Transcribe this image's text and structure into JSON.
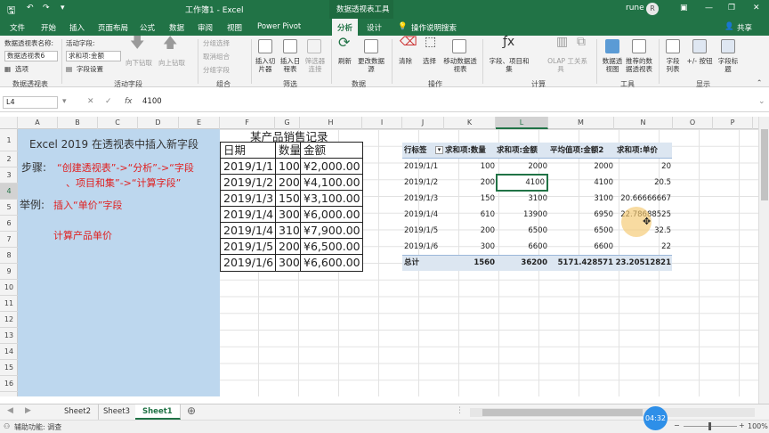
{
  "titlebar": {
    "title": "工作簿1 - Excel",
    "context_tool": "数据透视表工具",
    "user": "rune",
    "avatar": "R"
  },
  "tabs": [
    "文件",
    "开始",
    "插入",
    "页面布局",
    "公式",
    "数据",
    "审阅",
    "视图",
    "Power Pivot",
    "分析",
    "设计",
    "操作说明搜索"
  ],
  "share": "共享",
  "ribbon": {
    "pivot_name_label": "数据透视表名称:",
    "pivot_name_value": "数据透视表6",
    "options": "选项",
    "active_field_label": "活动字段:",
    "active_field_value": "求和项:金额",
    "field_settings": "字段设置",
    "drill_down": "向下钻取",
    "drill_up": "向上钻取",
    "group_selection": "分组选择",
    "ungroup": "取消组合",
    "group_field": "分组字段",
    "insert_slicer": "插入切片器",
    "insert_timeline": "插入日程表",
    "filter_connections": "筛选器连接",
    "refresh": "刷新",
    "change_source": "更改数据源",
    "clear": "清除",
    "select": "选择",
    "move_pivot": "移动数据透视表",
    "fields_items": "字段、项目和集",
    "olap": "OLAP 工具",
    "relationships": "关系",
    "pivot_chart": "数据透视图",
    "recommended": "推荐的数据透视表",
    "field_list": "字段列表",
    "buttons": "+/- 按钮",
    "field_headers": "字段标题",
    "groups": [
      "数据透视表",
      "活动字段",
      "组合",
      "筛选",
      "数据",
      "操作",
      "计算",
      "工具",
      "显示"
    ]
  },
  "formula_bar": {
    "cell": "L4",
    "value": "4100",
    "fx": "fx"
  },
  "columns": [
    "A",
    "B",
    "C",
    "D",
    "E",
    "F",
    "G",
    "H",
    "I",
    "J",
    "K",
    "L",
    "M",
    "N",
    "O",
    "P"
  ],
  "rows": [
    "1",
    "2",
    "3",
    "4",
    "5",
    "6",
    "7",
    "8",
    "9",
    "10",
    "11",
    "12",
    "13",
    "14",
    "15",
    "16"
  ],
  "panel": {
    "title": "Excel 2019 在透视表中插入新字段",
    "step_label": "步骤:",
    "step_text1": "“创建透视表”->“分析”->“字段",
    "step_text2": "、项目和集”->“计算字段”",
    "example_label": "举例:",
    "example_text": "插入“单价”字段",
    "calc_text": "计算产品单价"
  },
  "sales": {
    "title": "某产品销售记录",
    "headers": [
      "日期",
      "数量",
      "金额"
    ],
    "rows": [
      [
        "2019/1/1",
        "100",
        "¥2,000.00"
      ],
      [
        "2019/1/2",
        "200",
        "¥4,100.00"
      ],
      [
        "2019/1/3",
        "150",
        "¥3,100.00"
      ],
      [
        "2019/1/4",
        "300",
        "¥6,000.00"
      ],
      [
        "2019/1/4",
        "310",
        "¥7,900.00"
      ],
      [
        "2019/1/5",
        "200",
        "¥6,500.00"
      ],
      [
        "2019/1/6",
        "300",
        "¥6,600.00"
      ]
    ]
  },
  "pivot": {
    "headers": [
      "行标签",
      "求和项:数量",
      "求和项:金额",
      "平均值项:金额2",
      "求和项:单价"
    ],
    "rows": [
      [
        "2019/1/1",
        "100",
        "2000",
        "2000",
        "20"
      ],
      [
        "2019/1/2",
        "200",
        "4100",
        "4100",
        "20.5"
      ],
      [
        "2019/1/3",
        "150",
        "3100",
        "3100",
        "20.66666667"
      ],
      [
        "2019/1/4",
        "610",
        "13900",
        "6950",
        "22.78688525"
      ],
      [
        "2019/1/5",
        "200",
        "6500",
        "6500",
        "32.5"
      ],
      [
        "2019/1/6",
        "300",
        "6600",
        "6600",
        "22"
      ]
    ],
    "total": [
      "总计",
      "1560",
      "36200",
      "5171.428571",
      "23.20512821"
    ]
  },
  "sheets": [
    "Sheet2",
    "Sheet3",
    "Sheet1"
  ],
  "status": {
    "left": "辅助功能: 调查",
    "zoom": "100%",
    "time": "04:32"
  }
}
